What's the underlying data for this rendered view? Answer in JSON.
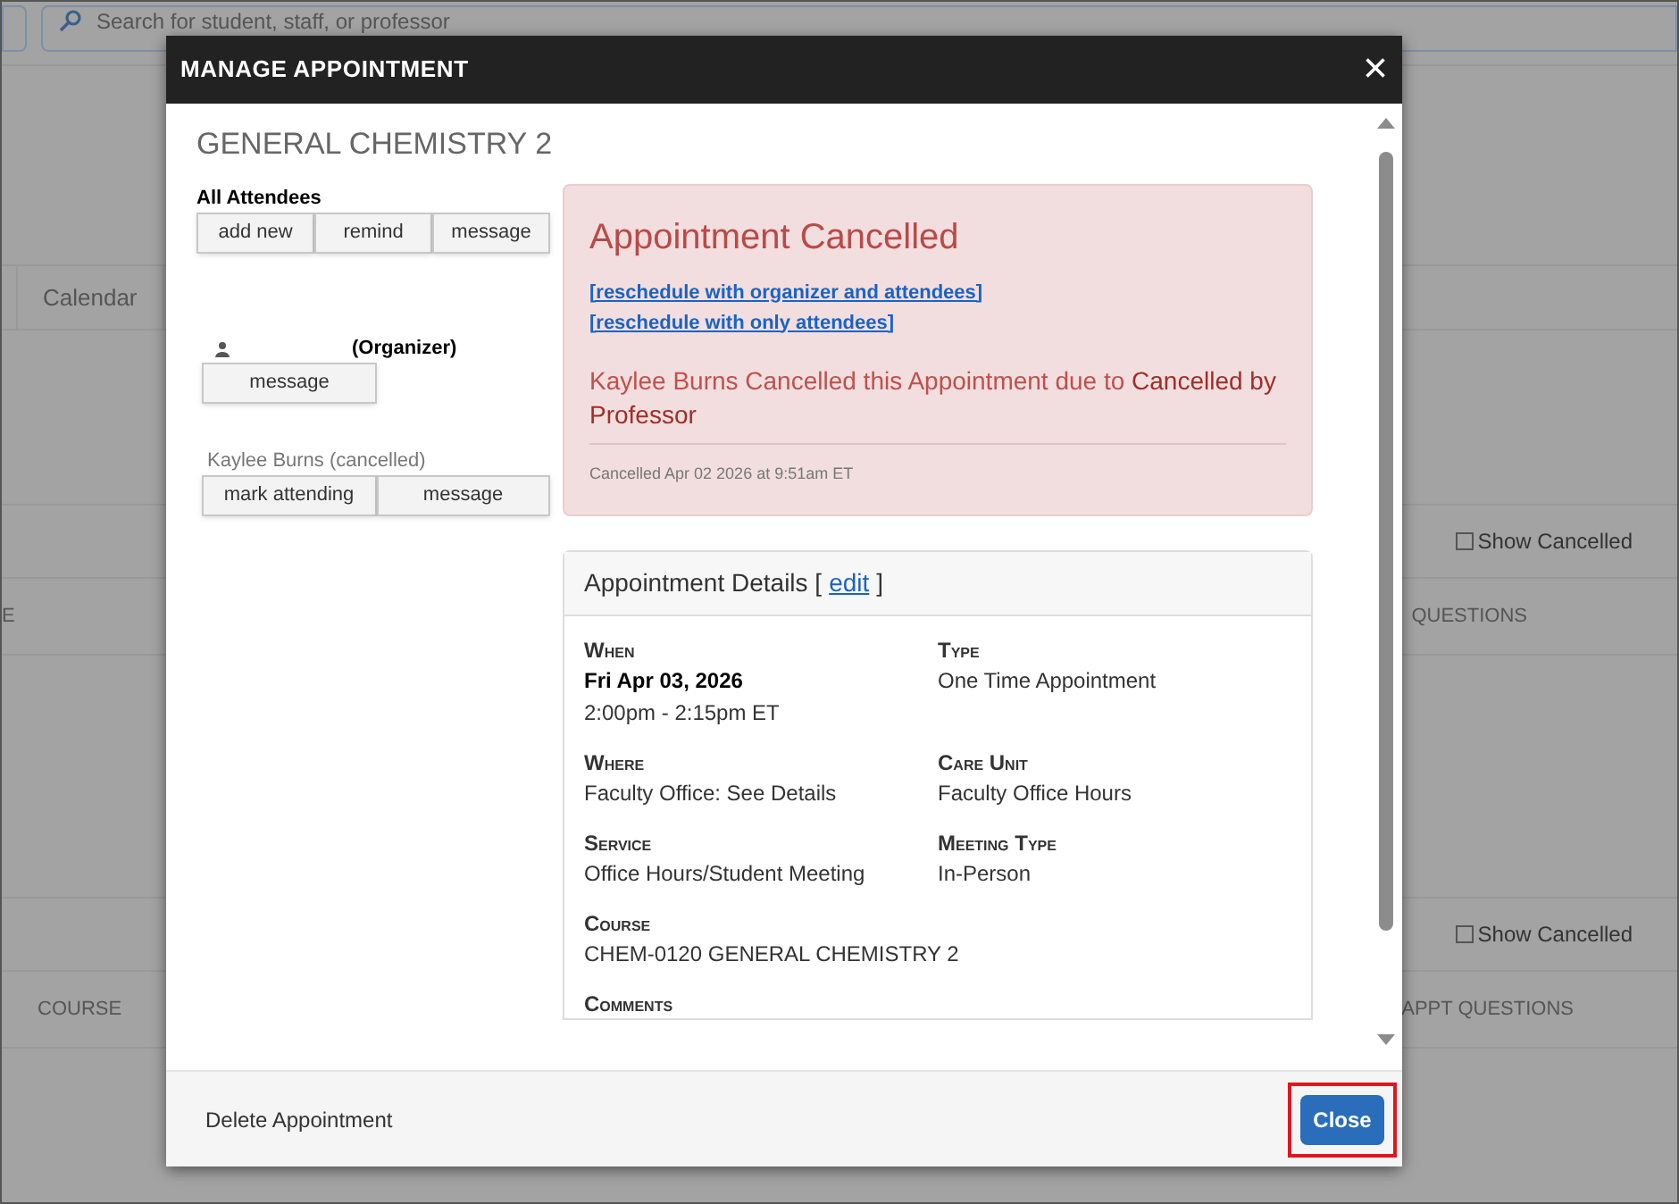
{
  "background": {
    "search": {
      "placeholder": "Search for student, staff, or professor"
    },
    "tabs": [
      {
        "label": "Calendar",
        "selected": false
      }
    ],
    "sections": [
      {
        "show_cancelled": {
          "label": "Show Cancelled",
          "checked": false
        },
        "columns_left": [
          "E"
        ],
        "columns_right": [
          "QUESTIONS"
        ]
      },
      {
        "show_cancelled": {
          "label": "Show Cancelled",
          "checked": false
        },
        "columns_left": [
          "COURSE"
        ],
        "columns_right": [
          "APPT QUESTIONS"
        ]
      }
    ]
  },
  "modal": {
    "title": "MANAGE APPOINTMENT",
    "close": "×",
    "heading": "GENERAL CHEMISTRY 2",
    "attendees": {
      "title": "All Attendees",
      "buttons": [
        "add new",
        "remind",
        "message"
      ]
    },
    "people": [
      {
        "role": "(Organizer)",
        "buttons": [
          "message"
        ]
      },
      {
        "name": "Kaylee Burns (cancelled)",
        "cancelled": true,
        "buttons": [
          "mark attending",
          "message"
        ]
      }
    ],
    "alert": {
      "title": "Appointment Cancelled",
      "links": [
        "[reschedule with organizer and attendees]",
        "[reschedule with only attendees]"
      ],
      "reason": "Kaylee Burns Cancelled this Appointment due to **Cancelled by Professor**",
      "stamp": "Cancelled Apr 02 2026 at 9:51am ET"
    },
    "details": {
      "title": "Appointment Details [",
      "edit": "edit",
      "title_end": "]",
      "fields": [
        {
          "label": "When",
          "lines": [
            {
              "text": "Fri Apr 03, 2026",
              "bold": true
            },
            {
              "text": "2:00pm - 2:15pm ET",
              "bold": false
            }
          ]
        },
        {
          "label": "Type",
          "lines": [
            {
              "text": "One Time Appointment",
              "bold": false
            }
          ]
        },
        {
          "label": "Where",
          "lines": [
            {
              "text": "Faculty Office: See Details",
              "bold": false
            }
          ]
        },
        {
          "label": "Care Unit",
          "lines": [
            {
              "text": "Faculty Office Hours",
              "bold": false
            }
          ]
        },
        {
          "label": "Service",
          "lines": [
            {
              "text": "Office Hours/Student Meeting",
              "bold": false
            }
          ]
        },
        {
          "label": "Meeting Type",
          "lines": [
            {
              "text": "In-Person",
              "bold": false
            }
          ]
        },
        {
          "label": "Course",
          "lines": [
            {
              "text": "CHEM-0120 GENERAL CHEMISTRY 2",
              "bold": false
            }
          ]
        },
        {
          "label": "Comments"
        }
      ]
    },
    "footer": {
      "delete": "Delete Appointment",
      "close_button": {
        "label": "Close",
        "highlighted": true
      }
    }
  }
}
